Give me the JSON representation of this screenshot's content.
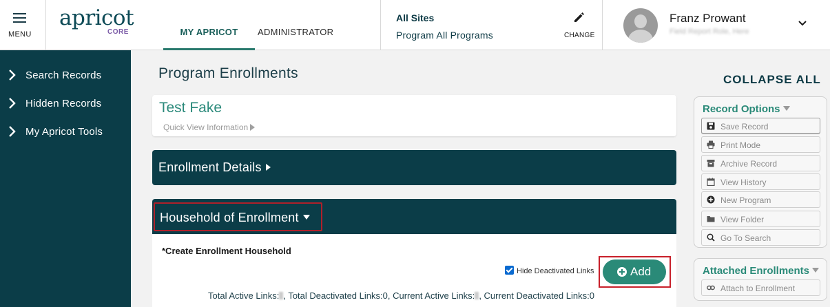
{
  "header": {
    "menu_label": "MENU",
    "logo_text": "apricot",
    "logo_sub": "CORE",
    "tabs": [
      {
        "label": "MY APRICOT",
        "active": true
      },
      {
        "label": "ADMINISTRATOR",
        "active": false
      }
    ],
    "sites_title": "All Sites",
    "program_label": "Program All Programs",
    "change_label": "CHANGE",
    "user_name": "Franz Prowant",
    "user_sub": "Field Report Role, Here"
  },
  "sidebar": {
    "items": [
      {
        "label": "Search Records"
      },
      {
        "label": "Hidden Records"
      },
      {
        "label": "My Apricot Tools"
      }
    ]
  },
  "main": {
    "page_title": "Program Enrollments",
    "client_name": "Test Fake",
    "quick_view_label": "Quick View Information",
    "enrollment_details_title": "Enrollment Details",
    "household_title": "Household of Enrollment",
    "create_household_label": "*Create Enrollment Household",
    "hide_deactivated_label": "Hide Deactivated Links",
    "hide_deactivated_checked": true,
    "add_button_label": "Add",
    "totals": {
      "total_active_label": "Total Active Links:",
      "total_deactivated_label": ", Total Deactivated Links:",
      "total_deactivated_value": "0",
      "current_active_label": ", Current Active Links:",
      "current_deactivated_label": ", Current Deactivated Links:",
      "current_deactivated_value": "0"
    }
  },
  "right_panel": {
    "collapse_all_label": "COLLAPSE ALL",
    "record_options_title": "Record Options",
    "record_options": [
      {
        "label": "Save Record",
        "icon": "save-icon"
      },
      {
        "label": "Print Mode",
        "icon": "print-icon"
      },
      {
        "label": "Archive Record",
        "icon": "archive-icon"
      },
      {
        "label": "View History",
        "icon": "calendar-icon"
      },
      {
        "label": "New Program",
        "icon": "plus-circle-icon"
      },
      {
        "label": "View Folder",
        "icon": "folder-icon"
      },
      {
        "label": "Go To Search",
        "icon": "search-icon"
      }
    ],
    "attached_title": "Attached Enrollments",
    "attach_button_label": "Attach to Enrollment"
  },
  "colors": {
    "sidebar_bg": "#0b3d48",
    "accent_green": "#2a8a78",
    "highlight_red": "#c8202a"
  }
}
